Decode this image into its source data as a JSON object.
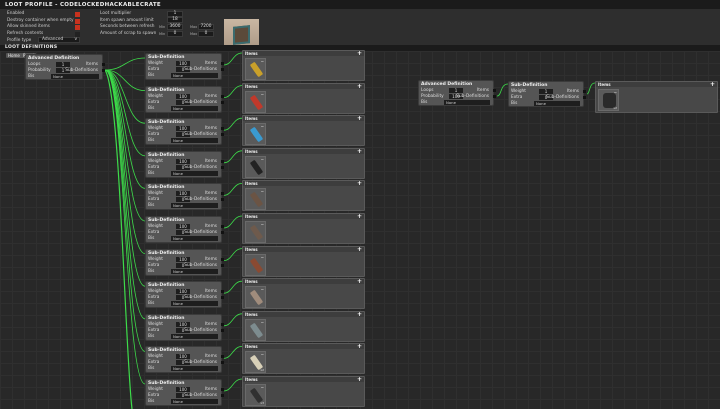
{
  "title": "LOOT PROFILE - CODELOCKEDHACKABLECRATE",
  "settings": {
    "enabled": {
      "label": "Enabled",
      "checked": true
    },
    "destroy_empty": {
      "label": "Destroy container when empty",
      "checked": true
    },
    "allow_skinned": {
      "label": "Allow skinned items",
      "checked": true
    },
    "refresh": {
      "label": "Refresh contents",
      "checked": false
    },
    "profile_type": {
      "label": "Profile type",
      "value": "Advanced"
    },
    "loot_multiplier": {
      "label": "Loot multiplier",
      "value": "1"
    },
    "spawn_limit": {
      "label": "Item spawn amount limit",
      "value": "18"
    },
    "refresh_seconds": {
      "label": "Seconds between refresh",
      "min_label": "Min",
      "min": "3600",
      "max_label": "Max",
      "max": "7200"
    },
    "scrap": {
      "label": "Amount of scrap to spawn",
      "min_label": "Min",
      "min": "0",
      "max_label": "Max",
      "max": "0"
    }
  },
  "definitions_title": "LOOT DEFINITIONS",
  "toolbar": {
    "home": "Home",
    "reset": "Reset"
  },
  "labels": {
    "advanced": "Advanced Definition",
    "sub": "Sub-Definition",
    "items": "Items",
    "loops": "Loops",
    "probability": "Probability",
    "bis": "Bis",
    "weight": "Weight",
    "extra": "Extra",
    "items_out": "Items",
    "subdefs_out": "Sub-Definitions",
    "none": "None",
    "plus": "+",
    "minus": "−"
  },
  "root": {
    "loops": "1",
    "probability": "1",
    "bis": "None"
  },
  "subdefs": [
    {
      "weight": "100",
      "extra": "0",
      "bis": "None",
      "item": "yellow-black-rocket",
      "color": "#c9a02a",
      "qty": ""
    },
    {
      "weight": "100",
      "extra": "0",
      "bis": "None",
      "item": "red-rocket",
      "color": "#c0392b",
      "qty": ""
    },
    {
      "weight": "100",
      "extra": "0",
      "bis": "None",
      "item": "blue-rocket",
      "color": "#3a9ad0",
      "qty": ""
    },
    {
      "weight": "100",
      "extra": "0",
      "bis": "None",
      "item": "rifle",
      "color": "#222222",
      "qty": ""
    },
    {
      "weight": "100",
      "extra": "0",
      "bis": "None",
      "item": "wooden-armor",
      "color": "#6b5444",
      "qty": ""
    },
    {
      "weight": "100",
      "extra": "0",
      "bis": "None",
      "item": "metal-door",
      "color": "#6e5a4c",
      "qty": ""
    },
    {
      "weight": "100",
      "extra": "0",
      "bis": "None",
      "item": "control-panel",
      "color": "#8a4a32",
      "qty": ""
    },
    {
      "weight": "100",
      "extra": "0",
      "bis": "None",
      "item": "helmet",
      "color": "#a08c7c",
      "qty": ""
    },
    {
      "weight": "100",
      "extra": "0",
      "bis": "None",
      "item": "lantern",
      "color": "#7d8c8f",
      "qty": ""
    },
    {
      "weight": "100",
      "extra": "0",
      "bis": "None",
      "item": "cloth-bundle",
      "color": "#d8d0b8",
      "qty": "x2"
    },
    {
      "weight": "100",
      "extra": "0",
      "bis": "None",
      "item": "tech-parts",
      "color": "#303030",
      "qty": "x3"
    }
  ],
  "right": {
    "loops": "1",
    "probability": "100",
    "bis": "None",
    "weight": "1",
    "extra": "0",
    "sub_bis": "None",
    "item": "armor-vest",
    "color": "#2a2a2a",
    "qty": "x2"
  },
  "colors": {
    "link": "#3ddc4a",
    "checkbox": "#c8321e"
  }
}
